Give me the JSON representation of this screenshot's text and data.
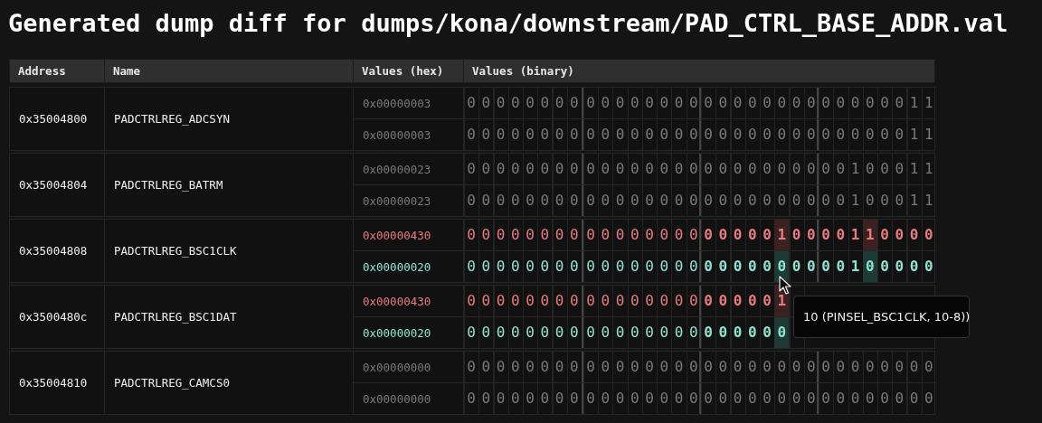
{
  "title": "Generated dump diff for dumps/kona/downstream/PAD_CTRL_BASE_ADDR.val",
  "table": {
    "columns": [
      "Address",
      "Name",
      "Values (hex)",
      "Values (binary)"
    ],
    "rows": [
      {
        "address": "0x35004800",
        "name": "PADCTRLREG_ADCSYN",
        "values": [
          {
            "kind": "same",
            "hex": "0x00000003",
            "bits": [
              "00000000",
              "00000000",
              "00000000",
              "00000011"
            ]
          },
          {
            "kind": "same",
            "hex": "0x00000003",
            "bits": [
              "00000000",
              "00000000",
              "00000000",
              "00000011"
            ]
          }
        ]
      },
      {
        "address": "0x35004804",
        "name": "PADCTRLREG_BATRM",
        "values": [
          {
            "kind": "same",
            "hex": "0x00000023",
            "bits": [
              "00000000",
              "00000000",
              "00000000",
              "00100011"
            ]
          },
          {
            "kind": "same",
            "hex": "0x00000023",
            "bits": [
              "00000000",
              "00000000",
              "00000000",
              "00100011"
            ]
          }
        ]
      },
      {
        "address": "0x35004808",
        "name": "PADCTRLREG_BSC1CLK",
        "values": [
          {
            "kind": "old",
            "hex": "0x00000430",
            "bits": [
              "00000000",
              "00000000",
              "00000100",
              "00110000"
            ]
          },
          {
            "kind": "new",
            "hex": "0x00000020",
            "bits": [
              "00000000",
              "00000000",
              "00000000",
              "00100000"
            ]
          }
        ]
      },
      {
        "address": "0x3500480c",
        "name": "PADCTRLREG_BSC1DAT",
        "values": [
          {
            "kind": "old",
            "hex": "0x00000430",
            "bits": [
              "00000000",
              "00000000",
              "000001"
            ]
          },
          {
            "kind": "new",
            "hex": "0x00000020",
            "bits": [
              "00000000",
              "00000000",
              "000000"
            ]
          }
        ]
      },
      {
        "address": "0x35004810",
        "name": "PADCTRLREG_CAMCS0",
        "values": [
          {
            "kind": "same",
            "hex": "0x00000000",
            "bits": [
              "00000000",
              "00000000",
              "00000000",
              "00000000"
            ]
          },
          {
            "kind": "same",
            "hex": "0x00000000",
            "bits": [
              "00000000",
              "00000000",
              "00000000",
              "00000000"
            ]
          }
        ]
      }
    ]
  },
  "tooltip": {
    "text": "10 (PINSEL_BSC1CLK, 10-8))"
  }
}
